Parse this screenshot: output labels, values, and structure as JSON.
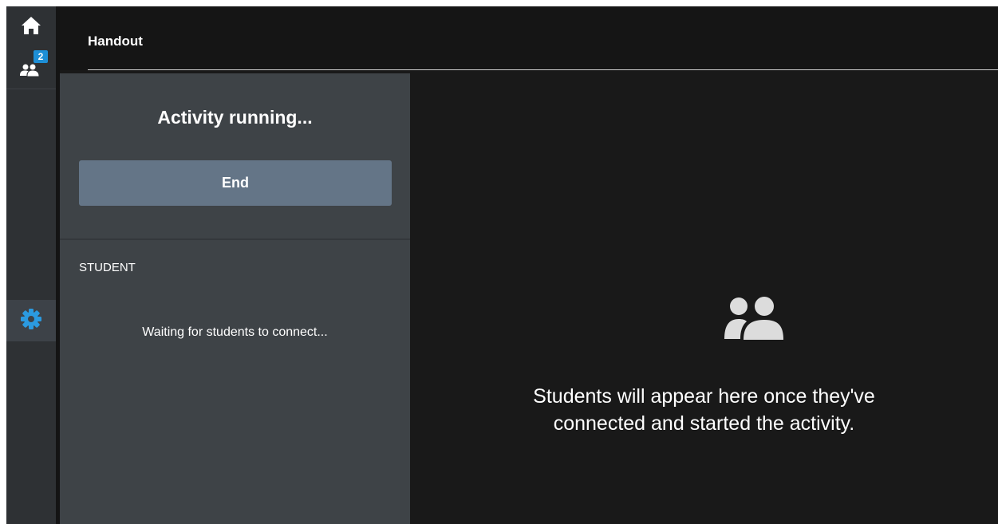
{
  "rail": {
    "home_icon": "home-icon",
    "students_icon": "students-icon",
    "students_badge": "2",
    "settings_icon": "gear-icon"
  },
  "header": {
    "title": "Handout"
  },
  "panel": {
    "status_title": "Activity running...",
    "end_label": "End",
    "section_label": "STUDENT",
    "waiting_text": "Waiting for students to connect..."
  },
  "main": {
    "empty_icon": "people-icon",
    "empty_line1": "Students will appear here once they've",
    "empty_line2": "connected and started the activity."
  },
  "colors": {
    "accent": "#1e8fd6",
    "end_button": "#647587",
    "panel_bg": "#3e4347",
    "rail_bg": "#2e3134",
    "main_bg": "#191919"
  }
}
